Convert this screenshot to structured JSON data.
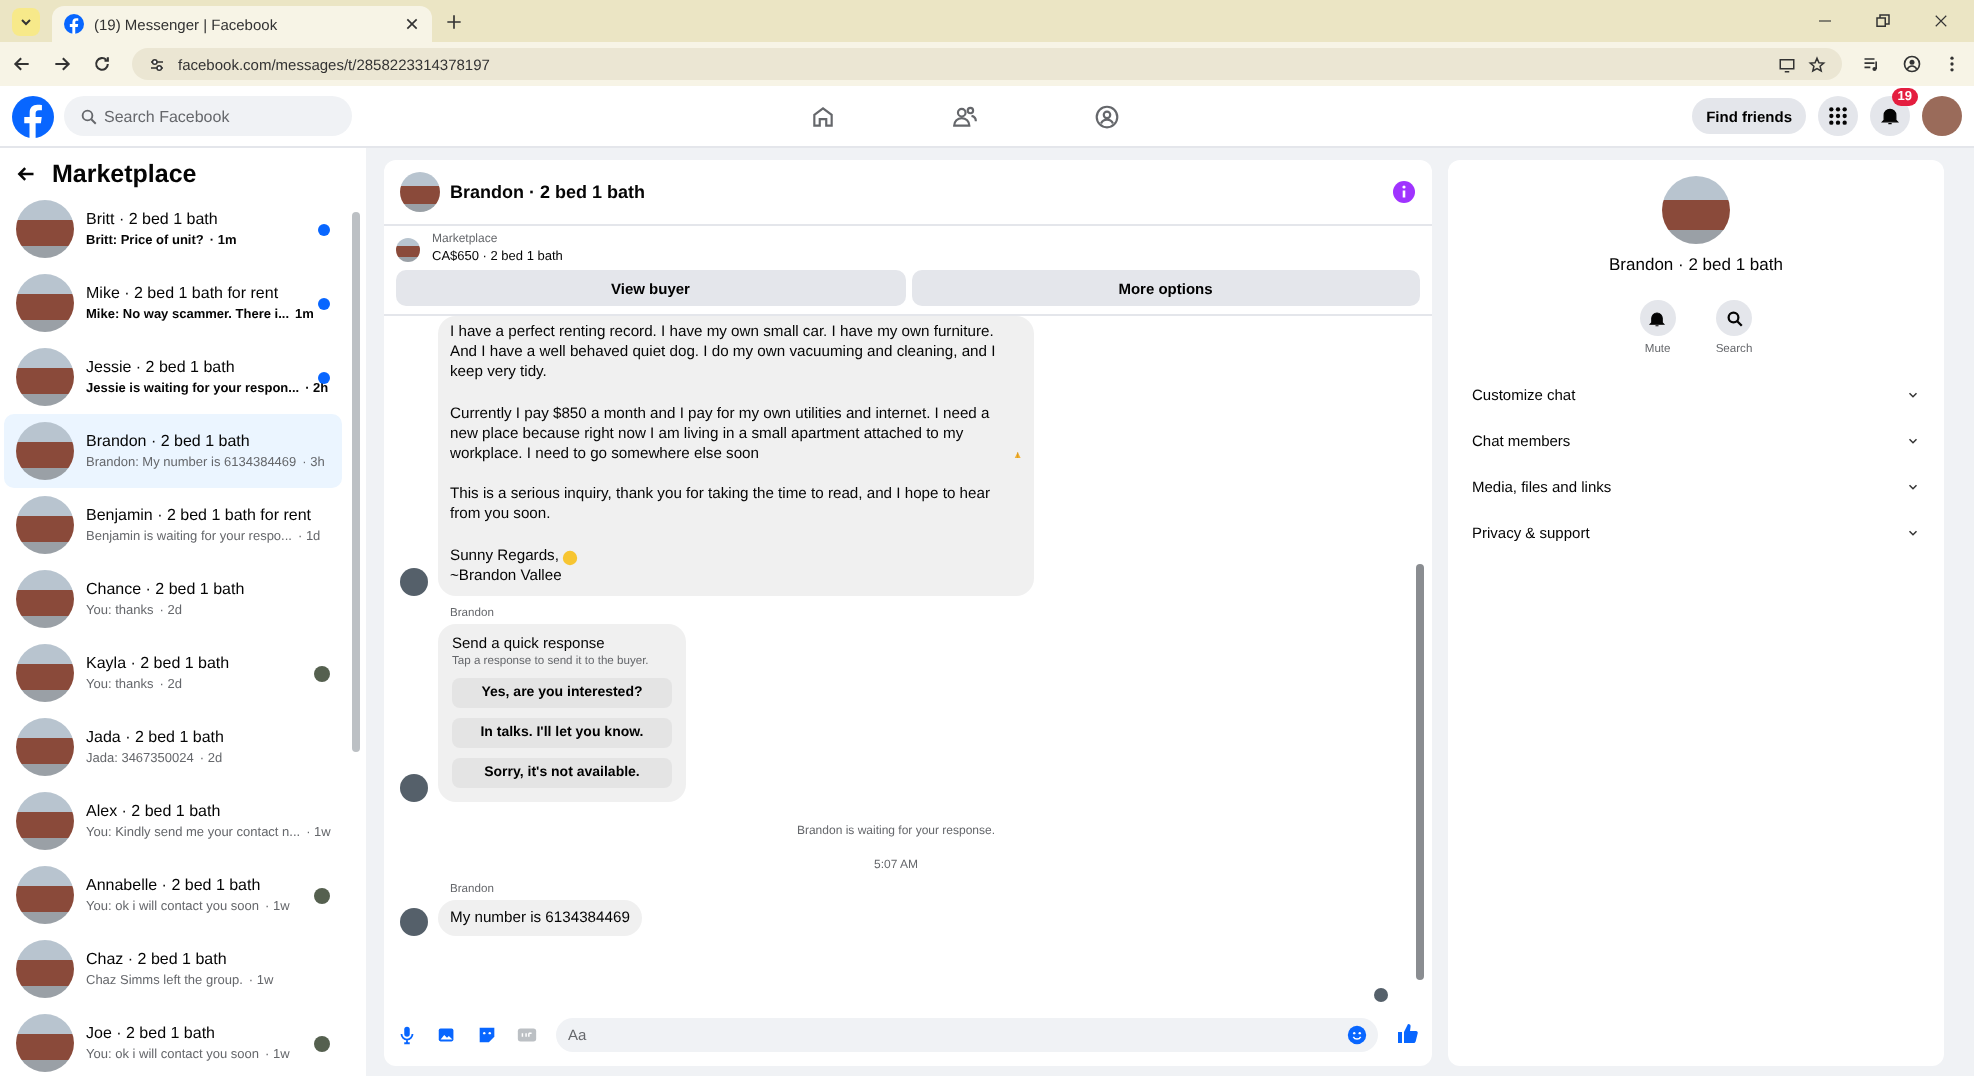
{
  "browser": {
    "tab_title": "(19) Messenger | Facebook",
    "url": "facebook.com/messages/t/2858223314378197"
  },
  "header": {
    "search": {
      "placeholder": "Search Facebook"
    },
    "find_friends": "Find friends",
    "notification_count": "19"
  },
  "sidebar": {
    "title": "Marketplace",
    "conversations": [
      {
        "title": "Britt · 2 bed 1 bath",
        "preview": "Britt: Price of unit?",
        "time": "· 1m",
        "unread": true,
        "seen": false,
        "selected": false
      },
      {
        "title": "Mike · 2 bed 1 bath for rent",
        "preview": "Mike: No way scammer. There i...",
        "time": "1m",
        "unread": true,
        "seen": false,
        "selected": false
      },
      {
        "title": "Jessie · 2 bed 1 bath",
        "preview": "Jessie is waiting for your respon...",
        "time": "· 2h",
        "unread": true,
        "seen": false,
        "selected": false
      },
      {
        "title": "Brandon · 2 bed 1 bath",
        "preview": "Brandon: My number is 6134384469",
        "time": "· 3h",
        "unread": false,
        "seen": false,
        "selected": true
      },
      {
        "title": "Benjamin · 2 bed 1 bath for rent",
        "preview": "Benjamin is waiting for your respo...",
        "time": "· 1d",
        "unread": false,
        "seen": false,
        "selected": false
      },
      {
        "title": "Chance · 2 bed 1 bath",
        "preview": "You: thanks",
        "time": "· 2d",
        "unread": false,
        "seen": false,
        "selected": false
      },
      {
        "title": "Kayla · 2 bed 1 bath",
        "preview": "You: thanks",
        "time": "· 2d",
        "unread": false,
        "seen": true,
        "selected": false
      },
      {
        "title": "Jada · 2 bed 1 bath",
        "preview": "Jada: 3467350024",
        "time": "· 2d",
        "unread": false,
        "seen": false,
        "selected": false
      },
      {
        "title": "Alex · 2 bed 1 bath",
        "preview": "You: Kindly send me your contact n...",
        "time": "· 1w",
        "unread": false,
        "seen": false,
        "selected": false
      },
      {
        "title": "Annabelle · 2 bed 1 bath",
        "preview": "You: ok i will contact you soon",
        "time": "· 1w",
        "unread": false,
        "seen": true,
        "selected": false
      },
      {
        "title": "Chaz · 2 bed 1 bath",
        "preview": "Chaz Simms left the group.",
        "time": "· 1w",
        "unread": false,
        "seen": false,
        "selected": false
      },
      {
        "title": "Joe · 2 bed 1 bath",
        "preview": "You: ok i will contact you soon",
        "time": "· 1w",
        "unread": false,
        "seen": true,
        "selected": false
      }
    ]
  },
  "chat": {
    "title": "Brandon · 2 bed 1 bath",
    "listing": {
      "label": "Marketplace",
      "item": "CA$650 · 2 bed 1 bath"
    },
    "buttons": [
      "View buyer",
      "More options"
    ],
    "messages": [
      {
        "kind": "text",
        "paragraphs": [
          {
            "text": "I have a perfect renting record. I have my own small car. I have my own furniture. And I have a well behaved quiet dog. I do my own vacuuming and cleaning, and I keep very tidy.",
            "kind": "plain"
          },
          {
            "text": "Currently I pay $850 a month and I pay for my own utilities and internet. I need a new place because right now I am living in a small apartment attached to my workplace. I need to go somewhere else soon",
            "kind": "hands"
          },
          {
            "text": "This is a serious inquiry, thank you for taking the time to read, and I hope to hear from you soon.",
            "kind": "plain"
          },
          {
            "text": "Sunny Regards,",
            "kind": "sun"
          },
          {
            "text": "~Brandon Vallee",
            "kind": "plain"
          }
        ]
      },
      {
        "kind": "quick_response",
        "sender": "Brandon",
        "title": "Send a quick response",
        "subtitle": "Tap a response to send it to the buyer.",
        "options": [
          "Yes, are you interested?",
          "In talks. I'll let you know.",
          "Sorry, it's not available."
        ]
      },
      {
        "kind": "notice",
        "text": "Brandon is waiting for your response."
      },
      {
        "kind": "timestamp",
        "text": "5:07 AM"
      },
      {
        "kind": "text",
        "sender": "Brandon",
        "paragraphs": [
          {
            "text": "My number is 6134384469",
            "kind": "plain"
          }
        ]
      }
    ],
    "composer": {
      "placeholder": "Aa"
    }
  },
  "details": {
    "name": "Brandon · 2 bed 1 bath",
    "actions": [
      {
        "kind": "mute",
        "label": "Mute"
      },
      {
        "kind": "search",
        "label": "Search"
      }
    ],
    "sections": [
      {
        "label": "Customize chat",
        "expanded": false
      },
      {
        "label": "Chat members",
        "expanded": false
      },
      {
        "label": "Media, files and links",
        "expanded": false
      },
      {
        "label": "Privacy & support",
        "expanded": false
      }
    ]
  }
}
